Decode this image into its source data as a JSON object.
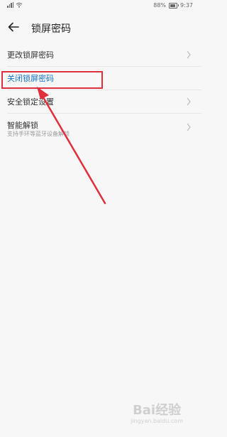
{
  "status_bar": {
    "battery": "88%",
    "battery_level": 0.88,
    "time": "9:37"
  },
  "header": {
    "title": "锁屏密码"
  },
  "items": [
    {
      "label": "更改锁屏密码"
    },
    {
      "label": "关闭锁屏密码"
    },
    {
      "label": "安全锁定设置"
    },
    {
      "label": "智能解锁",
      "sub": "支持手环等蓝牙设备解锁"
    }
  ],
  "watermark": {
    "text": "Bai经验",
    "sub": "jingyan.baidu.com"
  },
  "colors": {
    "accent": "#1a73c8",
    "annotation": "#e0303d"
  }
}
